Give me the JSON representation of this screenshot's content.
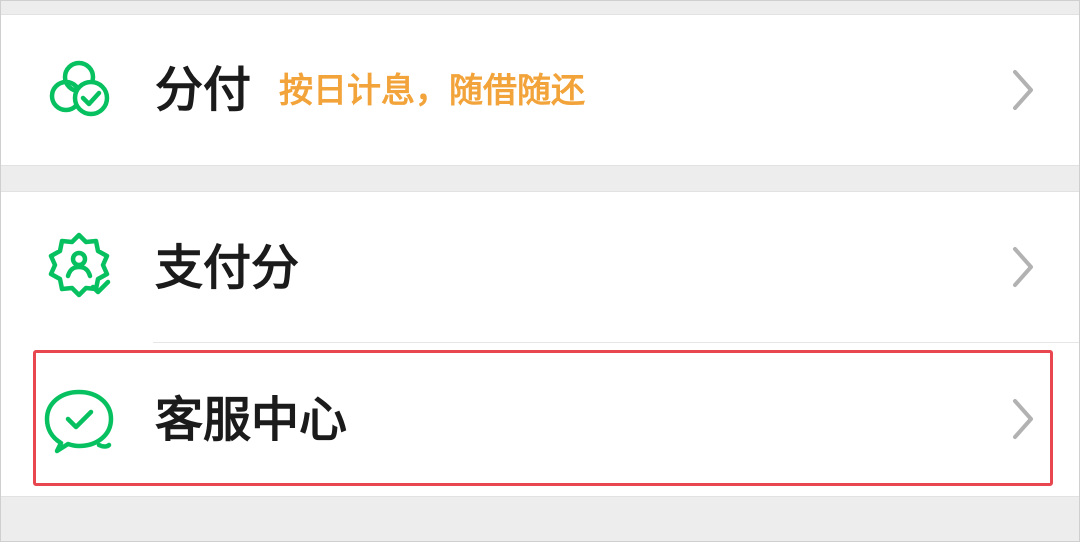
{
  "menu": {
    "items": [
      {
        "label": "分付",
        "subtitle": "按日计息，随借随还",
        "icon": "fenfu-circles-check-icon",
        "chevron": "chevron-right-icon"
      },
      {
        "label": "支付分",
        "icon": "badge-person-check-icon",
        "chevron": "chevron-right-icon"
      },
      {
        "label": "客服中心",
        "icon": "chat-bubble-check-icon",
        "chevron": "chevron-right-icon",
        "highlighted": true
      }
    ]
  },
  "colors": {
    "icon_green": "#07c160",
    "subtitle_orange": "#f2a33a",
    "label_text": "#1b1b1b",
    "highlight_red": "#e8474f",
    "chevron_gray": "#b2b2b2",
    "background": "#ededed"
  }
}
